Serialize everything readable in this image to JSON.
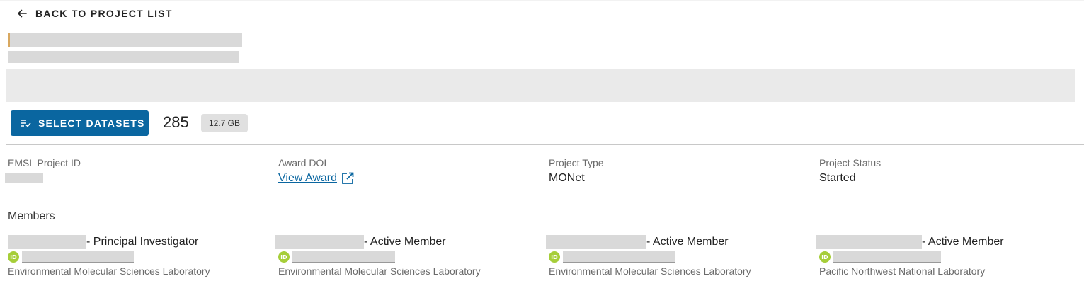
{
  "nav": {
    "back_label": "BACK TO PROJECT LIST"
  },
  "actions": {
    "select_datasets_label": "SELECT DATASETS",
    "dataset_count": "285",
    "total_size": "12.7 GB"
  },
  "details": {
    "emsl_project_id": {
      "label": "EMSL Project ID",
      "value": ""
    },
    "award_doi": {
      "label": "Award DOI",
      "link_text": "View Award"
    },
    "project_type": {
      "label": "Project Type",
      "value": "MONet"
    },
    "project_status": {
      "label": "Project Status",
      "value": "Started"
    }
  },
  "members": {
    "title": "Members",
    "list": [
      {
        "role": "- Principal Investigator",
        "org": "Environmental Molecular Sciences Laboratory"
      },
      {
        "role": "- Active Member",
        "org": "Environmental Molecular Sciences Laboratory"
      },
      {
        "role": "- Active Member",
        "org": "Environmental Molecular Sciences Laboratory"
      },
      {
        "role": "- Active Member",
        "org": "Pacific Northwest National Laboratory"
      }
    ]
  },
  "colors": {
    "primary": "#0a66a0",
    "orcid": "#a6ce39",
    "redaction": "#d9d9d9"
  },
  "icons": {
    "back": "arrow-left-icon",
    "select": "checklist-icon",
    "external": "open-in-new-icon",
    "orcid": "orcid-icon"
  }
}
